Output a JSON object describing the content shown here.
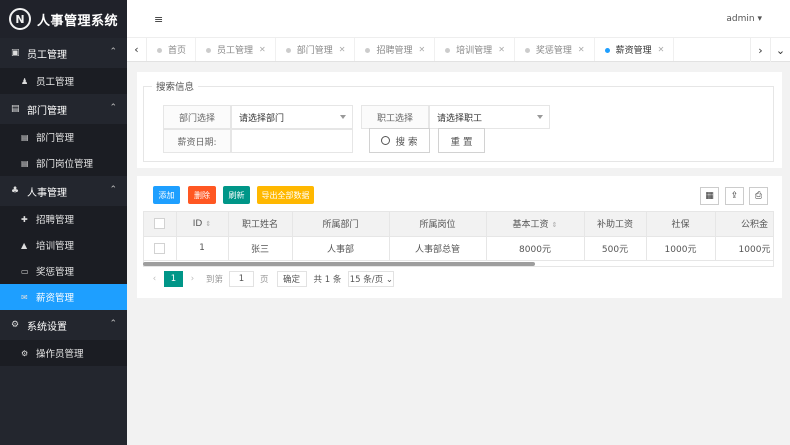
{
  "app": {
    "logo_letter": "N",
    "title": "人事管理系统"
  },
  "header": {
    "menu_icon": "≡",
    "user": "admin ▾"
  },
  "sidebar": [
    {
      "label": "员工管理",
      "icon": "▣",
      "items": [
        {
          "label": "员工管理",
          "icon": "♟",
          "active": false
        }
      ]
    },
    {
      "label": "部门管理",
      "icon": "▤",
      "items": [
        {
          "label": "部门管理",
          "icon": "▤",
          "active": false
        },
        {
          "label": "部门岗位管理",
          "icon": "▤",
          "active": false
        }
      ]
    },
    {
      "label": "人事管理",
      "icon": "♣",
      "items": [
        {
          "label": "招聘管理",
          "icon": "✚",
          "active": false
        },
        {
          "label": "培训管理",
          "icon": "▲",
          "active": false
        },
        {
          "label": "奖惩管理",
          "icon": "▭",
          "active": false
        },
        {
          "label": "薪资管理",
          "icon": "✉",
          "active": true
        }
      ]
    },
    {
      "label": "系统设置",
      "icon": "⚙",
      "items": [
        {
          "label": "操作员管理",
          "icon": "⚙",
          "active": false
        }
      ]
    }
  ],
  "tabs": {
    "prev": "‹",
    "next": "›",
    "more": "⌄",
    "items": [
      {
        "label": "首页",
        "closable": false,
        "active": false
      },
      {
        "label": "员工管理",
        "closable": true,
        "active": false
      },
      {
        "label": "部门管理",
        "closable": true,
        "active": false
      },
      {
        "label": "招聘管理",
        "closable": true,
        "active": false
      },
      {
        "label": "培训管理",
        "closable": true,
        "active": false
      },
      {
        "label": "奖惩管理",
        "closable": true,
        "active": false
      },
      {
        "label": "薪资管理",
        "closable": true,
        "active": true
      }
    ]
  },
  "search": {
    "legend": "搜索信息",
    "dept_label": "部门选择",
    "dept_value": "请选择部门",
    "emp_label": "职工选择",
    "emp_value": "请选择职工",
    "date_label": "薪资日期:",
    "search_button": "搜 索",
    "reset_button": "重 置"
  },
  "toolbar": {
    "add": "添加",
    "add_color": "#1e9fff",
    "delete": "删除",
    "delete_color": "#ff5722",
    "refresh": "刷新",
    "refresh_color": "#009688",
    "export": "导出全部数据",
    "export_color": "#ffb800"
  },
  "table": {
    "columns": [
      "ID",
      "职工姓名",
      "所属部门",
      "所属岗位",
      "基本工资",
      "补助工资",
      "社保",
      "公积金"
    ],
    "sortable": [
      "ID",
      "基本工资"
    ],
    "rows": [
      [
        "1",
        "张三",
        "人事部",
        "人事部总管",
        "8000元",
        "500元",
        "1000元",
        "1000元"
      ]
    ]
  },
  "pager": {
    "prev": "‹",
    "current": "1",
    "next": "›",
    "goto_label": "到第",
    "goto_value": "1",
    "page_unit": "页",
    "confirm": "确定",
    "total": "共 1 条",
    "page_size": "15 条/页 ⌄"
  }
}
